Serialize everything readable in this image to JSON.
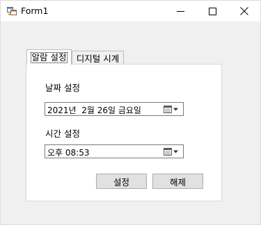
{
  "window": {
    "title": "Form1",
    "app_icon": "winforms-app-icon"
  },
  "titlebar_buttons": {
    "minimize_icon": "minimize-icon",
    "maximize_icon": "maximize-icon",
    "close_icon": "close-icon"
  },
  "tabs": [
    {
      "label": "알람 설정",
      "selected": true
    },
    {
      "label": "디지털 시계",
      "selected": false
    }
  ],
  "date_section": {
    "label": "날짜 설정",
    "value": "2021년  2월 26일 금요일",
    "dropdown_icon": "calendar-dropdown-icon"
  },
  "time_section": {
    "label": "시간 설정",
    "value": "오후 08:53",
    "dropdown_icon": "calendar-dropdown-icon"
  },
  "buttons": {
    "set_label": "설정",
    "clear_label": "해제"
  }
}
